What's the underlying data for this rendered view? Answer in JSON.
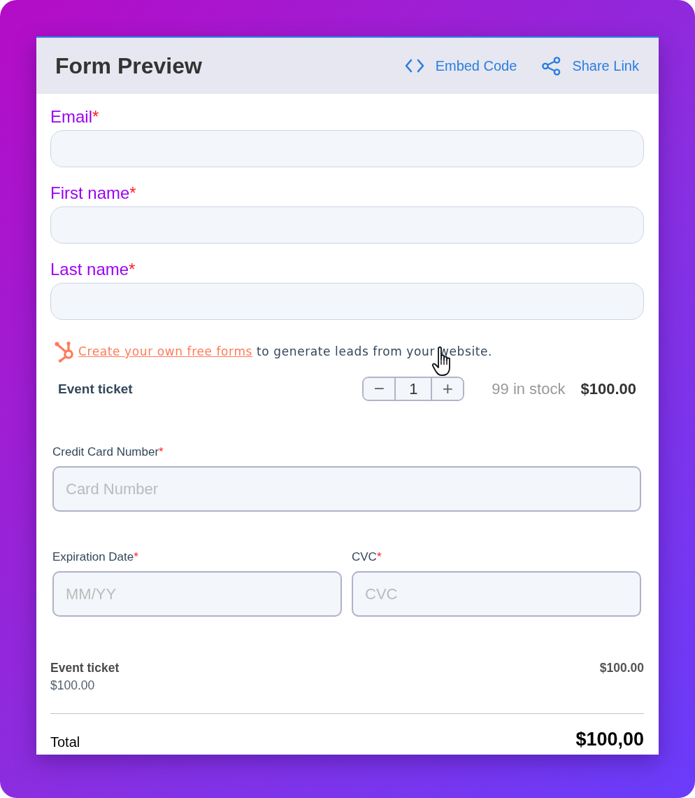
{
  "header": {
    "title": "Form Preview",
    "actions": [
      {
        "kind": "embed",
        "label": "Embed Code"
      },
      {
        "kind": "share",
        "label": "Share Link"
      }
    ]
  },
  "contact_fields": [
    {
      "label": "Email",
      "required_mark": "*"
    },
    {
      "label": "First name",
      "required_mark": "*"
    },
    {
      "label": "Last name",
      "required_mark": "*"
    }
  ],
  "promo": {
    "link": "Create your own free forms",
    "text": "to generate leads from your website."
  },
  "product": {
    "name": "Event ticket",
    "decrement": "−",
    "quantity": "1",
    "increment": "+",
    "stock": "99 in stock",
    "price": "$100.00"
  },
  "payment_fields": [
    {
      "label": "Credit Card Number",
      "required_mark": "*",
      "placeholder": "Card Number"
    },
    {
      "label": "Expiration Date",
      "required_mark": "*",
      "placeholder": "MM/YY"
    },
    {
      "label": "CVC",
      "required_mark": "*",
      "placeholder": "CVC"
    }
  ],
  "summary": {
    "items": [
      {
        "name": "Event ticket",
        "unit_price": "$100.00",
        "amount": "$100.00"
      }
    ],
    "total_label": "Total",
    "total": "$100,00"
  }
}
